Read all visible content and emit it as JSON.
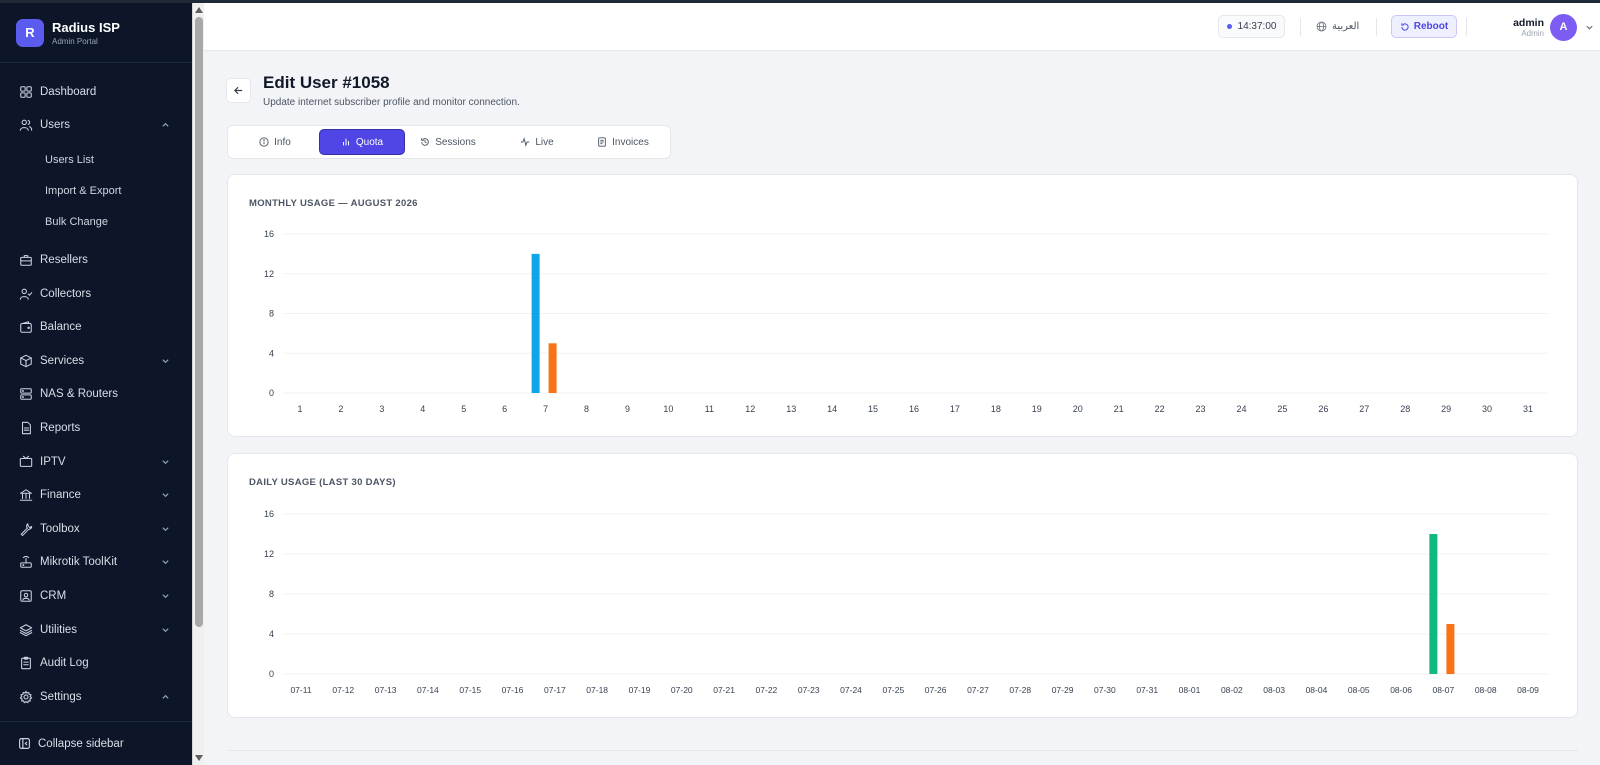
{
  "app": {
    "name": "Radius ISP",
    "subtitle": "Admin Portal",
    "logo_letter": "R"
  },
  "sidebar": {
    "items": [
      {
        "label": "Dashboard",
        "icon": "dashboard-icon"
      },
      {
        "label": "Users",
        "icon": "users-icon",
        "expanded": true,
        "children": [
          {
            "label": "Users List"
          },
          {
            "label": "Import & Export"
          },
          {
            "label": "Bulk Change"
          }
        ]
      },
      {
        "label": "Resellers",
        "icon": "briefcase-icon"
      },
      {
        "label": "Collectors",
        "icon": "user-check-icon"
      },
      {
        "label": "Balance",
        "icon": "wallet-icon"
      },
      {
        "label": "Services",
        "icon": "package-icon",
        "has_children": true
      },
      {
        "label": "NAS & Routers",
        "icon": "server-icon"
      },
      {
        "label": "Reports",
        "icon": "file-icon"
      },
      {
        "label": "IPTV",
        "icon": "tv-icon",
        "has_children": true
      },
      {
        "label": "Finance",
        "icon": "bank-icon",
        "has_children": true
      },
      {
        "label": "Toolbox",
        "icon": "wrench-icon",
        "has_children": true
      },
      {
        "label": "Mikrotik ToolKit",
        "icon": "router-icon",
        "has_children": true
      },
      {
        "label": "CRM",
        "icon": "contact-icon",
        "has_children": true
      },
      {
        "label": "Utilities",
        "icon": "layers-icon",
        "has_children": true
      },
      {
        "label": "Audit Log",
        "icon": "clipboard-icon"
      },
      {
        "label": "Settings",
        "icon": "gear-icon",
        "expanded": true
      }
    ],
    "collapse_label": "Collapse sidebar"
  },
  "header": {
    "clock": "14:37:00",
    "language": "العربية",
    "reboot_label": "Reboot",
    "user_name": "admin",
    "user_role": "Admin",
    "avatar_letter": "A"
  },
  "page": {
    "title": "Edit User #1058",
    "subtitle": "Update internet subscriber profile and monitor connection."
  },
  "tabs": [
    {
      "label": "Info",
      "icon": "info-icon",
      "active": false
    },
    {
      "label": "Quota",
      "icon": "bar-chart-icon",
      "active": true
    },
    {
      "label": "Sessions",
      "icon": "history-icon",
      "active": false
    },
    {
      "label": "Live",
      "icon": "activity-icon",
      "active": false
    },
    {
      "label": "Invoices",
      "icon": "invoice-icon",
      "active": false
    }
  ],
  "colors": {
    "accent": "#4f46e5",
    "sidebar_bg": "#0d1629",
    "download": "#0ea5e9",
    "upload": "#f97316",
    "daily_download": "#10b981"
  },
  "chart_data": [
    {
      "type": "bar",
      "title": "MONTHLY USAGE — AUGUST 2026",
      "categories": [
        "1",
        "2",
        "3",
        "4",
        "5",
        "6",
        "7",
        "8",
        "9",
        "10",
        "11",
        "12",
        "13",
        "14",
        "15",
        "16",
        "17",
        "18",
        "19",
        "20",
        "21",
        "22",
        "23",
        "24",
        "25",
        "26",
        "27",
        "28",
        "29",
        "30",
        "31"
      ],
      "series": [
        {
          "color": "#0ea5e9",
          "values": [
            0,
            0,
            0,
            0,
            0,
            0,
            14,
            0,
            0,
            0,
            0,
            0,
            0,
            0,
            0,
            0,
            0,
            0,
            0,
            0,
            0,
            0,
            0,
            0,
            0,
            0,
            0,
            0,
            0,
            0,
            0
          ]
        },
        {
          "color": "#f97316",
          "values": [
            0,
            0,
            0,
            0,
            0,
            0,
            5,
            0,
            0,
            0,
            0,
            0,
            0,
            0,
            0,
            0,
            0,
            0,
            0,
            0,
            0,
            0,
            0,
            0,
            0,
            0,
            0,
            0,
            0,
            0,
            0
          ]
        }
      ],
      "yticks": [
        0,
        4,
        8,
        12,
        16
      ],
      "ylim": [
        0,
        16
      ],
      "grid": true
    },
    {
      "type": "bar",
      "title": "DAILY USAGE (LAST 30 DAYS)",
      "categories": [
        "07-11",
        "07-12",
        "07-13",
        "07-14",
        "07-15",
        "07-16",
        "07-17",
        "07-18",
        "07-19",
        "07-20",
        "07-21",
        "07-22",
        "07-23",
        "07-24",
        "07-25",
        "07-26",
        "07-27",
        "07-28",
        "07-29",
        "07-30",
        "07-31",
        "08-01",
        "08-02",
        "08-03",
        "08-04",
        "08-05",
        "08-06",
        "08-07",
        "08-08",
        "08-09"
      ],
      "series": [
        {
          "color": "#10b981",
          "values": [
            0,
            0,
            0,
            0,
            0,
            0,
            0,
            0,
            0,
            0,
            0,
            0,
            0,
            0,
            0,
            0,
            0,
            0,
            0,
            0,
            0,
            0,
            0,
            0,
            0,
            0,
            0,
            14,
            0,
            0
          ]
        },
        {
          "color": "#f97316",
          "values": [
            0,
            0,
            0,
            0,
            0,
            0,
            0,
            0,
            0,
            0,
            0,
            0,
            0,
            0,
            0,
            0,
            0,
            0,
            0,
            0,
            0,
            0,
            0,
            0,
            0,
            0,
            0,
            5,
            0,
            0
          ]
        }
      ],
      "yticks": [
        0,
        4,
        8,
        12,
        16
      ],
      "ylim": [
        0,
        16
      ],
      "grid": true
    }
  ]
}
